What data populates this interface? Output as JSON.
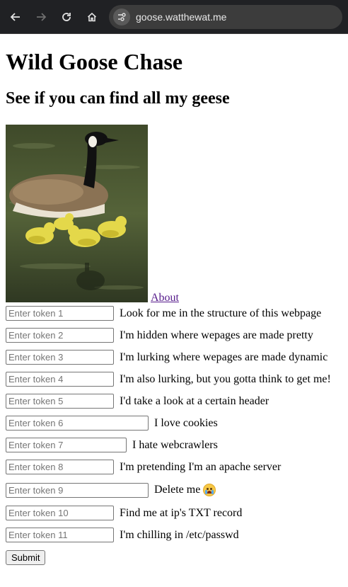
{
  "browser": {
    "url": "goose.watthewat.me"
  },
  "page": {
    "title": "Wild Goose Chase",
    "subtitle": "See if you can find all my geese",
    "about_link": "About",
    "image_alt": "Canada goose with goslings swimming",
    "submit_label": "Submit"
  },
  "tokens": [
    {
      "placeholder": "Enter token 1",
      "hint": "Look for me in the structure of this webpage"
    },
    {
      "placeholder": "Enter token 2",
      "hint": "I'm hidden where wepages are made pretty"
    },
    {
      "placeholder": "Enter token 3",
      "hint": "I'm lurking where wepages are made dynamic"
    },
    {
      "placeholder": "Enter token 4",
      "hint": "I'm also lurking, but you gotta think to get me!"
    },
    {
      "placeholder": "Enter token 5",
      "hint": "I'd take a look at a certain header"
    },
    {
      "placeholder": "Enter token 6",
      "hint": "I love cookies"
    },
    {
      "placeholder": "Enter token 7",
      "hint": "I hate webcrawlers"
    },
    {
      "placeholder": "Enter token 8",
      "hint": "I'm pretending I'm an apache server"
    },
    {
      "placeholder": "Enter token 9",
      "hint": "Delete me",
      "emoji": "loudly-crying-face-icon"
    },
    {
      "placeholder": "Enter token 10",
      "hint": "Find me at ip's TXT record"
    },
    {
      "placeholder": "Enter token 11",
      "hint": "I'm chilling in /etc/passwd"
    }
  ]
}
